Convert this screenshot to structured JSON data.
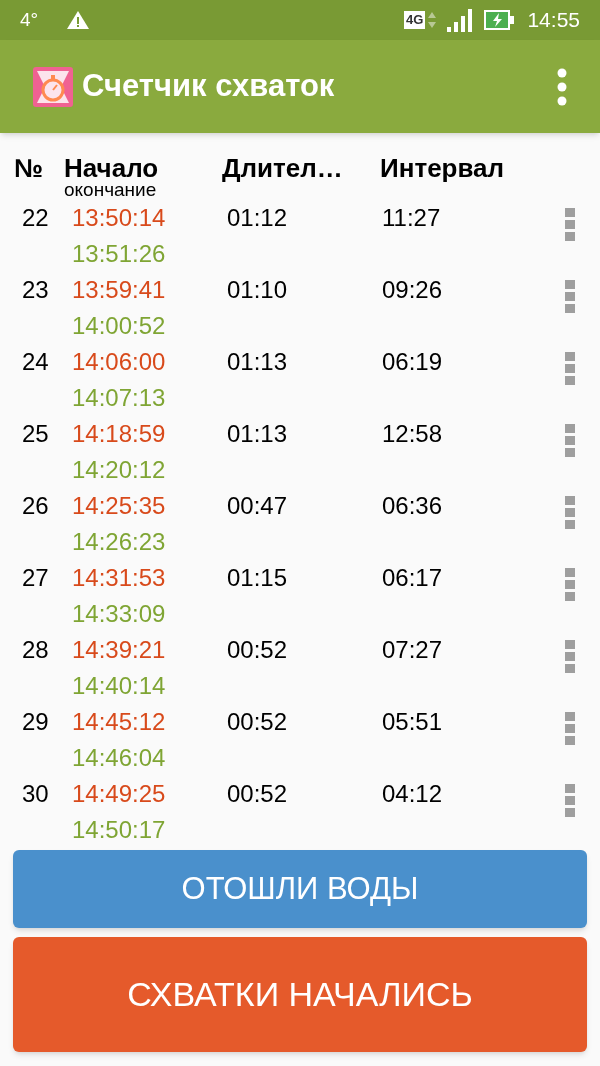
{
  "status_bar": {
    "temperature": "4°",
    "time": "14:55",
    "network": "4G"
  },
  "app_bar": {
    "title": "Счетчик схваток"
  },
  "table": {
    "columns": [
      {
        "label": "№"
      },
      {
        "label": "Начало",
        "sublabel": "окончание"
      },
      {
        "label": "Длител…"
      },
      {
        "label": "Интервал"
      }
    ],
    "rows": [
      {
        "number": "22",
        "start": "13:50:14",
        "end": "13:51:26",
        "duration": "01:12",
        "interval": "11:27"
      },
      {
        "number": "23",
        "start": "13:59:41",
        "end": "14:00:52",
        "duration": "01:10",
        "interval": "09:26"
      },
      {
        "number": "24",
        "start": "14:06:00",
        "end": "14:07:13",
        "duration": "01:13",
        "interval": "06:19"
      },
      {
        "number": "25",
        "start": "14:18:59",
        "end": "14:20:12",
        "duration": "01:13",
        "interval": "12:58"
      },
      {
        "number": "26",
        "start": "14:25:35",
        "end": "14:26:23",
        "duration": "00:47",
        "interval": "06:36"
      },
      {
        "number": "27",
        "start": "14:31:53",
        "end": "14:33:09",
        "duration": "01:15",
        "interval": "06:17"
      },
      {
        "number": "28",
        "start": "14:39:21",
        "end": "14:40:14",
        "duration": "00:52",
        "interval": "07:27"
      },
      {
        "number": "29",
        "start": "14:45:12",
        "end": "14:46:04",
        "duration": "00:52",
        "interval": "05:51"
      },
      {
        "number": "30",
        "start": "14:49:25",
        "end": "14:50:17",
        "duration": "00:52",
        "interval": "04:12"
      }
    ]
  },
  "buttons": [
    {
      "label": "ОТОШЛИ ВОДЫ",
      "kind": "water"
    },
    {
      "label": "СХВАТКИ НАЧАЛИСЬ",
      "kind": "contractions"
    }
  ]
}
